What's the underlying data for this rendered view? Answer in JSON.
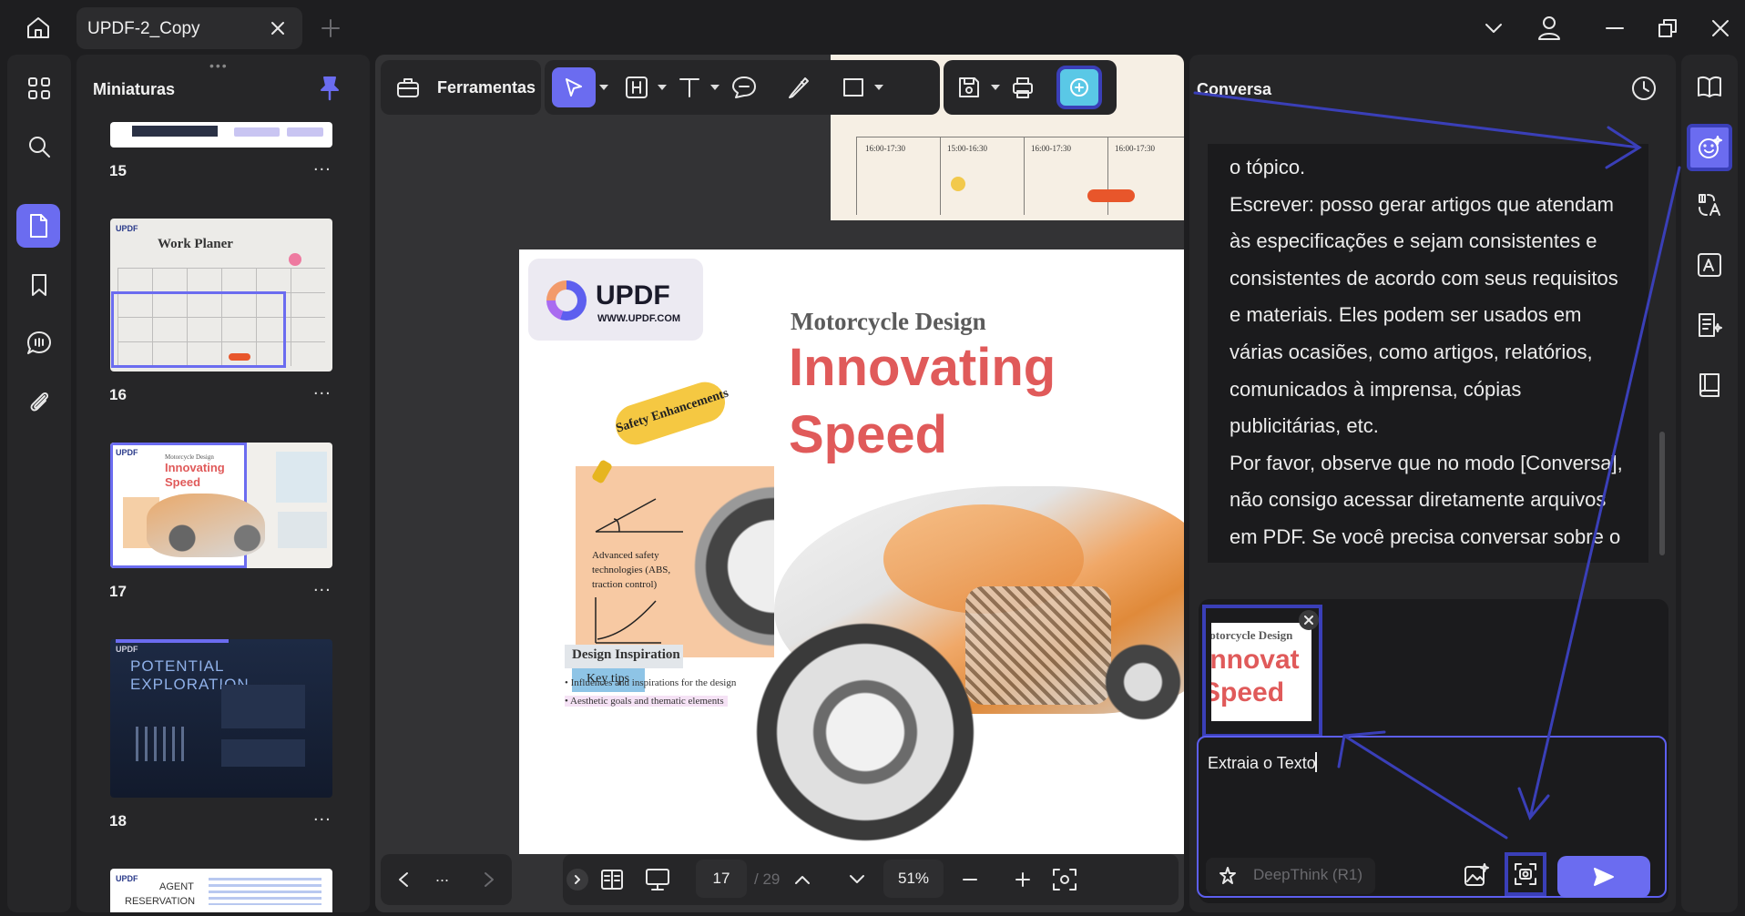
{
  "window": {
    "tab_title": "UPDF-2_Copy"
  },
  "thumbnails": {
    "title": "Miniaturas",
    "pages": [
      "15",
      "16",
      "17",
      "18"
    ],
    "more": "..."
  },
  "toolbar": {
    "tools_label": "Ferramentas"
  },
  "document": {
    "subtitle": "Motorcycle Design",
    "title_line1": "Innovating",
    "title_line2": "Speed",
    "logo_text": "UPDF",
    "logo_url": "WWW.UPDF.COM",
    "sticker": "Safety Enhancements",
    "note_text": "Advanced safety technologies (ABS, traction control)",
    "key_tips": "Key tips",
    "section_heading": "Design Inspiration",
    "bullets": [
      "Influences and inspirations for the design",
      "Aesthetic goals and thematic elements"
    ],
    "schedule": [
      "16:00-17:30",
      "15:00-16:30",
      "16:00-17:30",
      "16:00-17:30"
    ]
  },
  "thumb_texts": {
    "work_planer": "Work Planer",
    "innovating": "Innovating",
    "speed": "Speed",
    "motorcycle": "Motorcycle Design",
    "potential": "POTENTIAL EXPLORATION",
    "agent": "AGENT",
    "reservation": "RESERVATION"
  },
  "bottom": {
    "more": "...",
    "current_page": "17",
    "total_pages": "/ 29",
    "zoom": "51%"
  },
  "chat": {
    "title": "Conversa",
    "lines": [
      "o tópico.",
      "Escrever: posso gerar artigos que atendam",
      "às especificações e sejam consistentes e",
      "consistentes de acordo com seus requisitos",
      "e materiais. Eles podem ser usados em",
      "várias ocasiões, como artigos, relatórios,",
      "comunicados à imprensa, cópias",
      "publicitárias, etc.",
      "Por favor, observe que no modo [Conversa],",
      "não consigo acessar diretamente arquivos",
      "em PDF. Se você precisa conversar sobre o"
    ],
    "attachment": {
      "line1": "Motorcycle Design",
      "line2": "Innovat",
      "line3": "Speed"
    },
    "input_value": "Extraia o Texto",
    "deepthink_label": "DeepThink (R1)"
  },
  "colors": {
    "accent": "#6b6cf0",
    "annotation": "#3a3fb8",
    "brand_red": "#e05a5a"
  }
}
